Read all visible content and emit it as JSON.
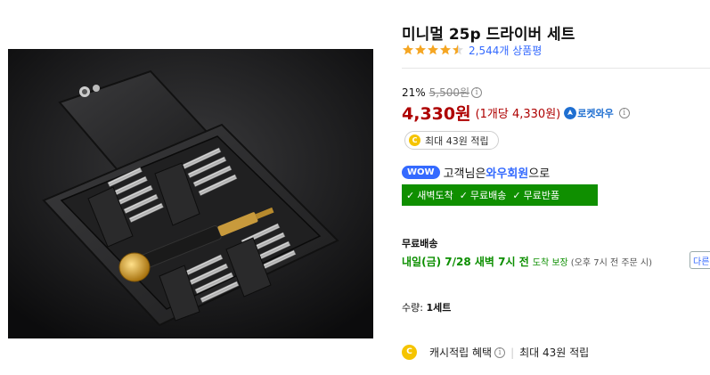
{
  "product": {
    "image_alt": "",
    "title": "미니멀 25p 드라이버 세트",
    "rating": 4.5,
    "review_count": "2,544개 상품평"
  },
  "price": {
    "discount_rate": "21%",
    "original_price": "5,500원",
    "info_glyph": "i",
    "sale_price": "4,330원",
    "unit_price": "(1개당 4,330원)",
    "rocket_label": "로켓와우"
  },
  "cashback": {
    "coin_glyph": "C",
    "pill_text": "최대 43원 적립"
  },
  "wow": {
    "badge": "WOW",
    "prefix": "고객님은 ",
    "member_link": "와우회원",
    "suffix": "으로"
  },
  "benefits": [
    {
      "label": "새벽도착"
    },
    {
      "label": "무료배송"
    },
    {
      "label": "무료반품"
    }
  ],
  "shipping": {
    "label": "무료배송",
    "delivery_date": "내일(금) 7/28 새벽 7시 전",
    "guarantee": "도착 보장",
    "cutoff": "(오후 7시 전 주문 시)",
    "other_button": "다른"
  },
  "quantity": {
    "label": "수량:",
    "value": "1세트"
  },
  "cash_benefit": {
    "coin_glyph": "C",
    "label": "캐시적립 혜택",
    "separator": "|",
    "amount": "최대 43원 적립"
  },
  "colors": {
    "accent_blue": "#346aff",
    "price_red": "#ae0000",
    "delivery_green": "#0c8f00",
    "benefit_bar_green": "#0f8f00",
    "star_orange": "#f5a623",
    "coin_yellow": "#f5c400"
  }
}
